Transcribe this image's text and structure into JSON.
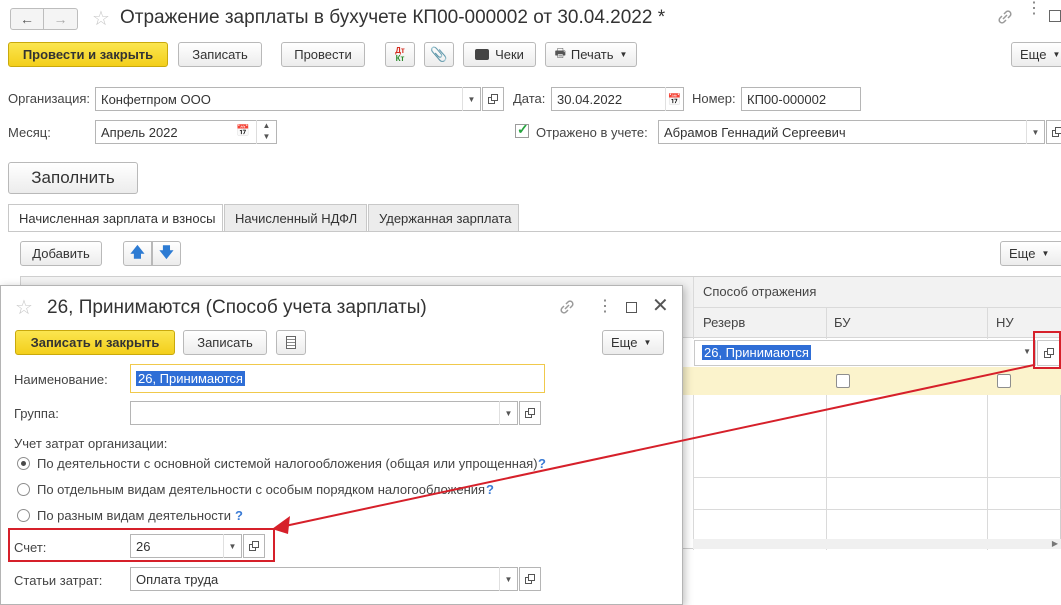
{
  "window": {
    "title": "Отражение зарплаты в бухучете КП00-000002 от 30.04.2022 *"
  },
  "toolbar": {
    "post_close": "Провести и закрыть",
    "save": "Записать",
    "post": "Провести",
    "dt_kt": "Дт Кт",
    "receipts": "Чеки",
    "print": "Печать",
    "more": "Еще"
  },
  "form": {
    "org_label": "Организация:",
    "org_value": "Конфетпром ООО",
    "date_label": "Дата:",
    "date_value": "30.04.2022",
    "number_label": "Номер:",
    "number_value": "КП00-000002",
    "month_label": "Месяц:",
    "month_value": "Апрель 2022",
    "reflected_label": "Отражено в учете:",
    "reflected_checked": true,
    "responsible_value": "Абрамов Геннадий Сергеевич",
    "fill_button": "Заполнить"
  },
  "tabs": [
    {
      "label": "Начисленная зарплата и взносы",
      "active": true
    },
    {
      "label": "Начисленный НДФЛ",
      "active": false
    },
    {
      "label": "Удержанная зарплата",
      "active": false
    }
  ],
  "table_toolbar": {
    "add": "Добавить",
    "more": "Еще"
  },
  "table": {
    "group_header": "Способ отражения",
    "col_reserve": "Резерв",
    "col_bu": "БУ",
    "col_nu": "НУ",
    "row_value": "26, Принимаются"
  },
  "dialog": {
    "title": "26, Принимаются (Способ учета зарплаты)",
    "save_close": "Записать и закрыть",
    "save": "Записать",
    "more": "Еще",
    "name_label": "Наименование:",
    "name_value": "26, Принимаются",
    "group_label": "Группа:",
    "group_value": "",
    "cost_accounting_label": "Учет затрат организации:",
    "options": [
      {
        "label": "По деятельности с основной системой налогообложения (общая или упрощенная)",
        "selected": true
      },
      {
        "label": "По отдельным видам деятельности с особым порядком налогообложения",
        "selected": false
      },
      {
        "label": "По разным видам деятельности",
        "selected": false
      }
    ],
    "help_mark": "?",
    "account_label": "Счет:",
    "account_value": "26",
    "cost_items_label": "Статьи затрат:",
    "cost_items_value": "Оплата труда"
  },
  "colors": {
    "accent_yellow": "#f5d31f",
    "annotation_red": "#d6202a",
    "selection_blue": "#2f6ed6",
    "row_highlight": "#fbf3cc"
  }
}
